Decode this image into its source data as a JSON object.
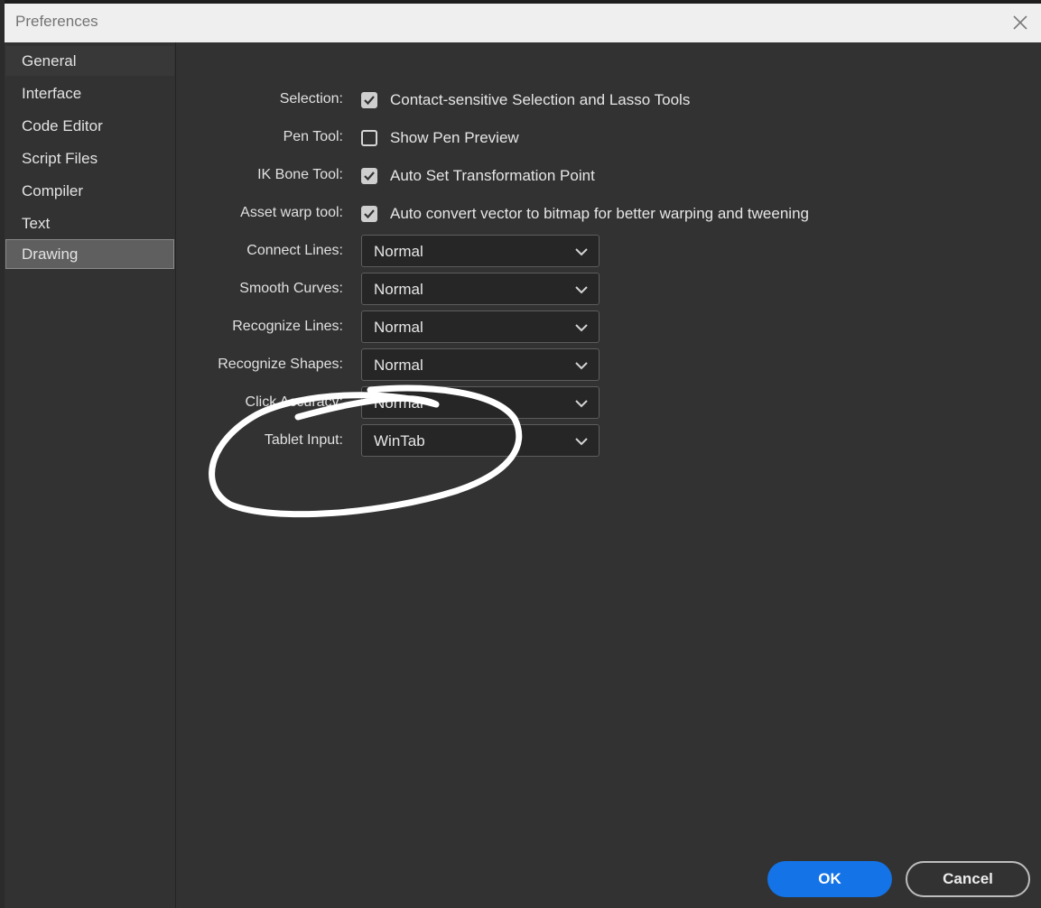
{
  "window": {
    "title": "Preferences",
    "close_icon": "close-icon"
  },
  "sidebar": {
    "items": [
      {
        "label": "General"
      },
      {
        "label": "Interface"
      },
      {
        "label": "Code Editor"
      },
      {
        "label": "Script Files"
      },
      {
        "label": "Compiler"
      },
      {
        "label": "Text"
      },
      {
        "label": "Drawing",
        "selected": true
      }
    ]
  },
  "settings": {
    "selection": {
      "label": "Selection:",
      "checked": true,
      "text": "Contact-sensitive Selection and Lasso Tools"
    },
    "pen_tool": {
      "label": "Pen Tool:",
      "checked": false,
      "text": "Show Pen Preview"
    },
    "ik_bone_tool": {
      "label": "IK Bone Tool:",
      "checked": true,
      "text": "Auto Set Transformation Point"
    },
    "asset_warp_tool": {
      "label": "Asset warp tool:",
      "checked": true,
      "text": "Auto convert vector to bitmap for better warping and tweening"
    },
    "connect_lines": {
      "label": "Connect Lines:",
      "value": "Normal"
    },
    "smooth_curves": {
      "label": "Smooth Curves:",
      "value": "Normal"
    },
    "recognize_lines": {
      "label": "Recognize Lines:",
      "value": "Normal"
    },
    "recognize_shapes": {
      "label": "Recognize Shapes:",
      "value": "Normal"
    },
    "click_accuracy": {
      "label": "Click Accuracy:",
      "value": "Normal"
    },
    "tablet_input": {
      "label": "Tablet Input:",
      "value": "WinTab"
    }
  },
  "buttons": {
    "ok": "OK",
    "cancel": "Cancel"
  },
  "colors": {
    "accent": "#1473e6",
    "background": "#323232",
    "titlebar": "#efefef",
    "annotation": "#ffffff"
  }
}
